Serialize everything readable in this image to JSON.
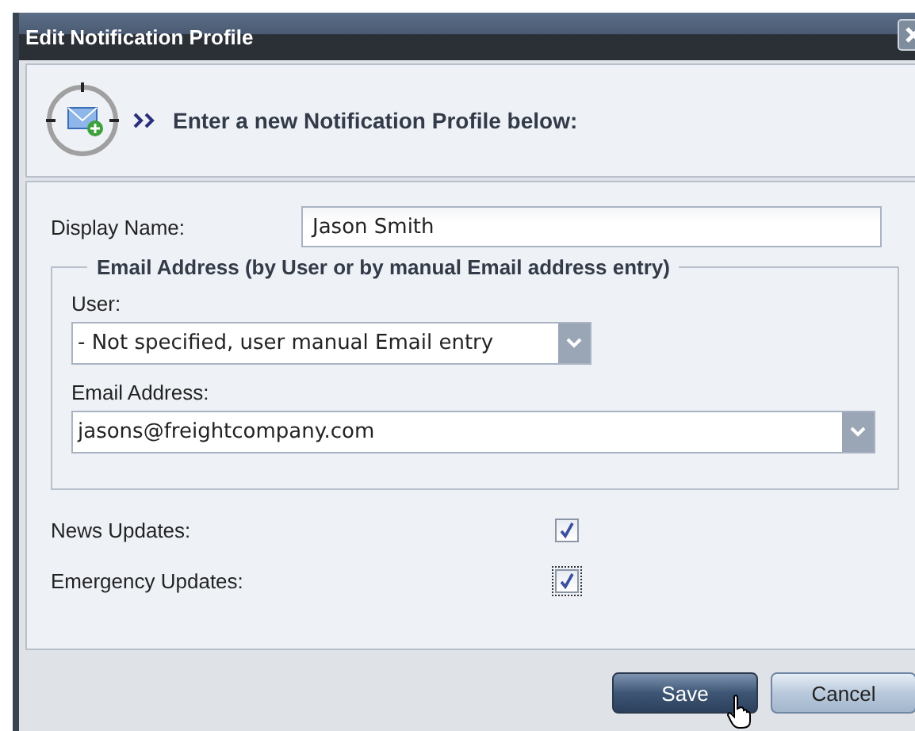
{
  "window": {
    "title": "Edit Notification Profile"
  },
  "header": {
    "text": "Enter a new Notification Profile below:"
  },
  "display_name": {
    "label": "Display Name:",
    "value": "Jason Smith"
  },
  "email_group": {
    "legend": "Email Address (by User or by manual Email address entry)",
    "user": {
      "label": "User:",
      "value": "- Not specified, user manual Email entry"
    },
    "email": {
      "label": "Email Address:",
      "value": "jasons@freightcompany.com"
    }
  },
  "options": [
    {
      "label": "News Updates:",
      "checked": true,
      "focused": false
    },
    {
      "label": "Emergency Updates:",
      "checked": true,
      "focused": true
    }
  ],
  "buttons": [
    {
      "label": "Save",
      "primary": true
    },
    {
      "label": "Cancel",
      "primary": false
    }
  ]
}
